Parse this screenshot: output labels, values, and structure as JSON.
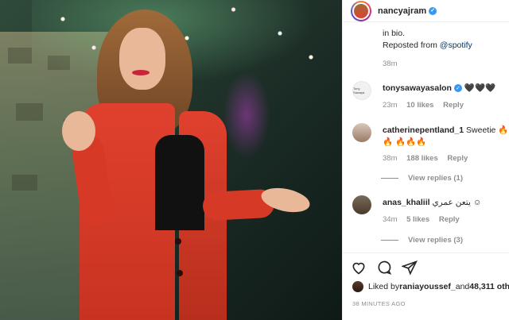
{
  "post": {
    "author": "nancyajram",
    "caption_line1": "in bio.",
    "caption_prefix": "Reposted from ",
    "caption_mention": "@spotify",
    "caption_time": "38m"
  },
  "comments": [
    {
      "username": "tonysawayasalon",
      "verified": true,
      "avatar_text": "Tony Sawaya",
      "text": "🖤🖤🖤",
      "time": "23m",
      "likes": "10 likes",
      "reply": "Reply"
    },
    {
      "username": "catherinepentland_1",
      "text": "Sweetie 🔥🔥 🔥🔥🔥",
      "time": "38m",
      "likes": "188 likes",
      "reply": "Reply",
      "view_replies": "View replies (1)"
    },
    {
      "username": "anas_khaliil",
      "text": "يتعن عمري ☺",
      "time": "34m",
      "likes": "5 likes",
      "reply": "Reply",
      "view_replies": "View replies (3)"
    }
  ],
  "likes": {
    "prefix": "Liked by ",
    "user": "raniayoussef_",
    "middle": " and ",
    "count": "48,311 oth"
  },
  "post_time": "38 MINUTES AGO",
  "colors": {
    "link": "#003569",
    "verified": "#3897f0",
    "muted": "#8e8e8e"
  },
  "icons": [
    "heart-icon",
    "comment-icon",
    "share-icon",
    "verified-badge-icon"
  ]
}
